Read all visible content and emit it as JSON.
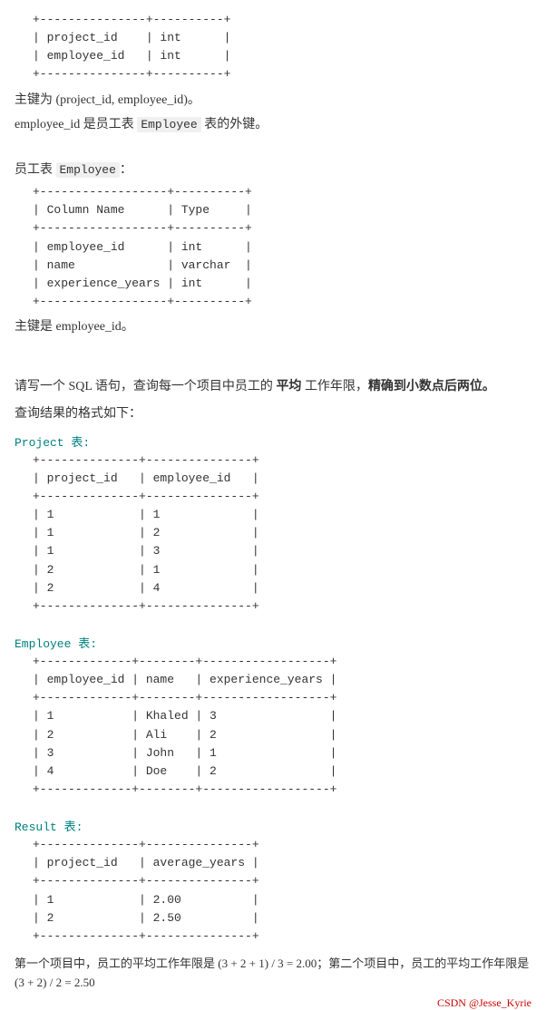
{
  "top_table": {
    "header_border": "+---------------+----------+",
    "rows": [
      "| project_id    | int      |",
      "| employee_id   | int      |"
    ],
    "footer_border": "+---------------+----------+"
  },
  "top_note1": "主键为 (project_id, employee_id)。",
  "top_note2_prefix": "employee_id 是员工表 ",
  "top_note2_code": "Employee",
  "top_note2_suffix": " 表的外键。",
  "employee_label_prefix": "员工表 ",
  "employee_label_code": "Employee",
  "employee_label_suffix": "：",
  "employee_table": {
    "header_border": "+------------------+----------+",
    "col_header": "| Column Name      | Type     |",
    "mid_border": "+------------------+----------+",
    "rows": [
      "| employee_id      | int      |",
      "| name             | varchar  |",
      "| experience_years | int      |"
    ],
    "footer_border": "+------------------+----------+"
  },
  "employee_pk": "主键是 employee_id。",
  "query_intro": "请写一个 SQL 语句，查询每一个项目中员工的 平均 工作年限，精确到小数点后两位。",
  "result_format_label": "查询结果的格式如下：",
  "project_table_label": "Project 表:",
  "project_table": {
    "header_border": "+--------------+---------------+",
    "col_header": "| project_id   | employee_id   |",
    "mid_border": "+--------------+---------------+",
    "rows": [
      "| 1            | 1             |",
      "| 1            | 2             |",
      "| 1            | 3             |",
      "| 2            | 1             |",
      "| 2            | 4             |"
    ],
    "footer_border": "+--------------+---------------+"
  },
  "employee_table2_label": "Employee 表:",
  "employee_table2": {
    "header_border": "+-------------+--------+------------------+",
    "col_header": "| employee_id | name   | experience_years |",
    "mid_border": "+-------------+--------+------------------+",
    "rows": [
      "| 1           | Khaled | 3                |",
      "| 2           | Ali    | 2                |",
      "| 3           | John   | 1                |",
      "| 4           | Doe    | 2                |"
    ],
    "footer_border": "+-------------+--------+------------------+"
  },
  "result_table_label": "Result 表:",
  "result_table": {
    "header_border": "+--------------+---------------+",
    "col_header": "| project_id   | average_years |",
    "mid_border": "+--------------+---------------+",
    "rows": [
      "| 1            | 2.00          |",
      "| 2            | 2.50          |"
    ],
    "footer_border": "+--------------+---------------+"
  },
  "bottom_note": "第一个项目中，员工的平均工作年限是 (3 + 2 + 1) / 3 = 2.00；第二个项目中，员工的平均工作年限是 (3 + 2) / 2 = 2.50",
  "csdn_tag": "CSDN @Jesse_Kyrie"
}
